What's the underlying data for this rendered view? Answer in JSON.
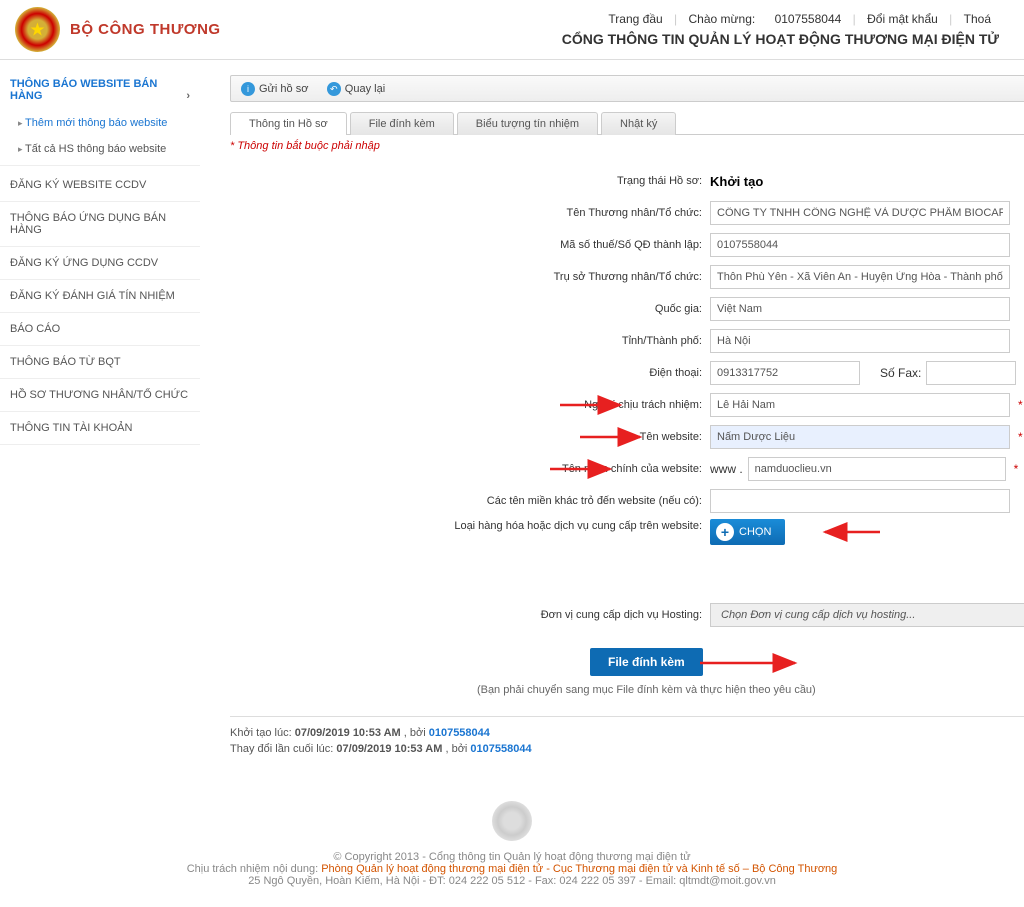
{
  "header": {
    "brand": "BỘ CÔNG THƯƠNG",
    "portal_title": "CỔNG THÔNG TIN QUẢN LÝ HOẠT ĐỘNG THƯƠNG MẠI ĐIỆN TỬ",
    "nav": {
      "home": "Trang đầu",
      "welcome_label": "Chào mừng:",
      "welcome_user": "0107558044",
      "change_pw": "Đổi mật khẩu",
      "logout": "Thoá"
    }
  },
  "sidebar": {
    "section1": {
      "title": "THÔNG BÁO WEBSITE BÁN HÀNG",
      "items": [
        {
          "label": "Thêm mới thông báo website",
          "active": true
        },
        {
          "label": "Tất cả HS thông báo website",
          "active": false
        }
      ]
    },
    "main_items": [
      "ĐĂNG KÝ WEBSITE CCDV",
      "THÔNG BÁO ỨNG DỤNG BÁN HÀNG",
      "ĐĂNG KÝ ỨNG DỤNG CCDV",
      "ĐĂNG KÝ ĐÁNH GIÁ TÍN NHIỆM",
      "BÁO CÁO",
      "THÔNG BÁO TỪ BQT",
      "HỒ SƠ THƯƠNG NHÂN/TỔ CHỨC",
      "THÔNG TIN TÀI KHOẢN"
    ]
  },
  "toolbar": {
    "send": "Gửi hồ sơ",
    "back": "Quay lại"
  },
  "tabs": [
    "Thông tin Hồ sơ",
    "File đính kèm",
    "Biểu tượng tín nhiệm",
    "Nhật ký"
  ],
  "required_note": "* Thông tin bắt buộc phải nhập",
  "form": {
    "status_label": "Trạng thái Hồ sơ:",
    "status_value": "Khởi tạo",
    "merchant_label": "Tên Thương nhân/Tổ chức:",
    "merchant_value": "CÔNG TY TNHH CÔNG NGHỆ VÀ DƯỢC PHẨM BIOCARE",
    "tax_label": "Mã số thuế/Số QĐ thành lập:",
    "tax_value": "0107558044",
    "hq_label": "Trụ sở Thương nhân/Tổ chức:",
    "hq_value": "Thôn Phù Yên - Xã Viên An - Huyện Ứng Hòa - Thành phố Hà Nội",
    "country_label": "Quốc gia:",
    "country_value": "Việt Nam",
    "province_label": "Tỉnh/Thành phố:",
    "province_value": "Hà Nội",
    "phone_label": "Điện thoại:",
    "phone_value": "0913317752",
    "fax_label": "Số Fax:",
    "fax_value": "",
    "responsible_label": "Người chịu trách nhiệm:",
    "responsible_value": "Lê Hải Nam",
    "site_name_label": "Tên website:",
    "site_name_value": "Nấm Dược Liệu",
    "domain_label": "Tên miền chính của website:",
    "domain_prefix": "www .",
    "domain_value": "namduoclieu.vn",
    "other_domains_label": "Các tên miền khác trỏ đến website (nếu có):",
    "other_domains_value": "",
    "goods_label": "Loại hàng hóa hoặc dịch vụ cung cấp trên website:",
    "chon_btn": "CHỌN",
    "hosting_label": "Đơn vị cung cấp dịch vụ Hosting:",
    "hosting_placeholder": "Chọn Đơn vị cung cấp dịch vụ hosting...",
    "file_attach_btn": "File đính kèm",
    "hint": "(Bạn phải chuyển sang mục File đính kèm và thực hiện theo yêu cầu)"
  },
  "meta": {
    "created_label": "Khởi tạo lúc:",
    "created_time": "07/09/2019 10:53 AM",
    "by": ", bởi",
    "created_user": "0107558044",
    "modified_label": "Thay đổi lần cuối lúc:",
    "modified_time": "07/09/2019 10:53 AM",
    "modified_user": "0107558044"
  },
  "footer": {
    "copyright": "© Copyright 2013 - Cổng thông tin Quản lý hoạt động thương mại điện tử",
    "line2_a": "Chịu trách nhiệm nội dung: ",
    "line2_b": "Phòng Quản lý hoạt động thương mại điện tử - Cục Thương mại điện tử và Kinh tế số – Bộ Công Thương",
    "line3": "25 Ngô Quyền, Hoàn Kiếm, Hà Nội - ĐT: 024 222 05 512 - Fax: 024 222 05 397 - Email: qltmdt@moit.gov.vn"
  }
}
